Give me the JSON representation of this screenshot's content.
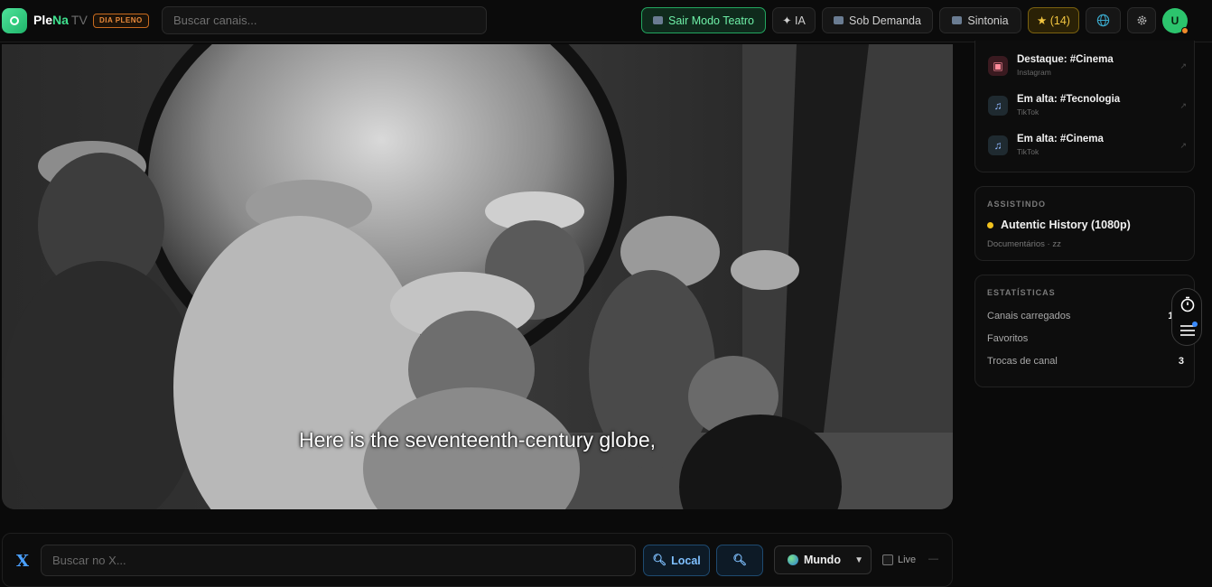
{
  "header": {
    "brand_part1": "Ple",
    "brand_part2": "Na",
    "brand_part3": "TV",
    "day_badge": "DIA PLENO",
    "search_placeholder": "Buscar canais...",
    "theater_label": "Sair Modo Teatro",
    "ia_label": "✦ IA",
    "demand_label": "Sob Demanda",
    "tune_label": "Sintonia",
    "favorites_label": "★ (14)",
    "avatar_initial": "U"
  },
  "video": {
    "subtitle": "Here is the seventeenth-century globe,"
  },
  "trends": [
    {
      "title": "Destaque: #Cinema",
      "source": "Instagram",
      "icon": "instagram-icon"
    },
    {
      "title": "Em alta: #Tecnologia",
      "source": "TikTok",
      "icon": "music-note-icon"
    },
    {
      "title": "Em alta: #Cinema",
      "source": "TikTok",
      "icon": "music-note-icon"
    }
  ],
  "watching": {
    "label": "ASSISTINDO",
    "title": "Autentic History (1080p)",
    "subtitle": "Documentários · zz"
  },
  "stats": {
    "label": "ESTATÍSTICAS",
    "rows": [
      {
        "label": "Canais carregados",
        "value": "119"
      },
      {
        "label": "Favoritos",
        "value": ""
      },
      {
        "label": "Trocas de canal",
        "value": "3"
      }
    ]
  },
  "bottom": {
    "x_logo": "X",
    "search_placeholder": "Buscar no X...",
    "local_label": "Local",
    "region_label": "Mundo",
    "live_label": "Live",
    "dash": "—"
  },
  "colors": {
    "accent_green": "#2cc46d",
    "favorites_gold": "#f3c640",
    "link_blue": "#7fc0ff"
  }
}
